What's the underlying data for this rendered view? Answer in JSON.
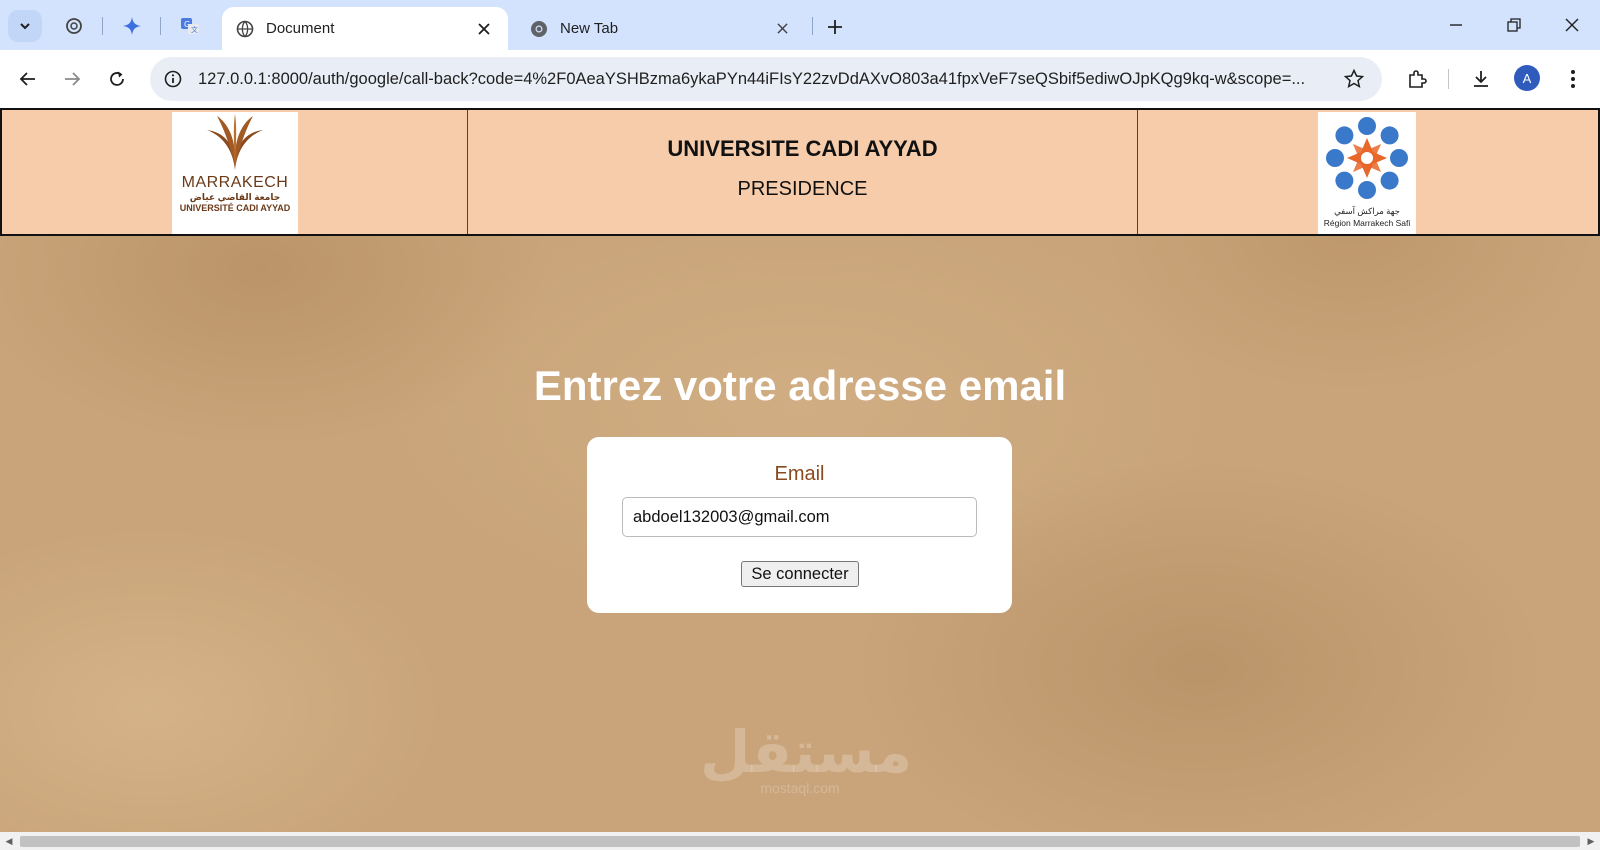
{
  "browser": {
    "tabs": [
      {
        "title": "Document",
        "icon": "globe-icon",
        "active": true
      },
      {
        "title": "New Tab",
        "icon": "chrome-icon",
        "active": false
      }
    ],
    "pinned_icons": [
      "openai-icon",
      "gemini-sparkle-icon",
      "translate-icon"
    ],
    "url": "127.0.0.1:8000/auth/google/call-back?code=4%2F0AeaYSHBzma6ykaPYn44iFIsY22zvDdAXvO803a41fpxVeF7seQSbif5ediwOJpKQg9kq-w&scope=...",
    "profile_initial": "A"
  },
  "header": {
    "logo_left_text": "MARRAKECH",
    "logo_left_arabic": "جامعة القاضي عياض",
    "logo_left_sub": "UNIVERSITÉ CADI AYYAD",
    "title": "UNIVERSITE CADI AYYAD",
    "subtitle": "PRESIDENCE",
    "logo_right_arabic": "جهة مراكش آسفي",
    "logo_right_text": "Région Marrakech Safi"
  },
  "main": {
    "heading": "Entrez votre adresse email",
    "form": {
      "label": "Email",
      "email_value": "abdoel132003@gmail.com",
      "submit_label": "Se connecter"
    }
  },
  "watermark": {
    "arabic": "مستقل",
    "latin": "mostaql.com"
  },
  "colors": {
    "header_bg": "#f6ccaa",
    "label_color": "#8a4a1e",
    "tabstrip_bg": "#d3e3fd"
  }
}
